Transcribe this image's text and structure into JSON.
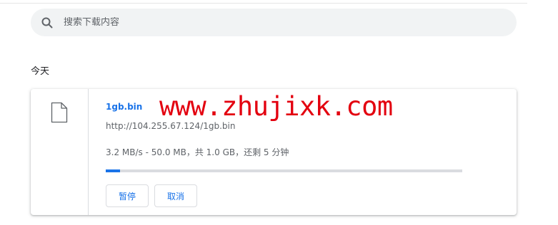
{
  "search": {
    "placeholder": "搜索下载内容"
  },
  "section": {
    "heading": "今天"
  },
  "download": {
    "file_name": "1gb.bin",
    "url": "http://104.255.67.124/1gb.bin",
    "status": "3.2 MB/s - 50.0 MB，共 1.0 GB，还剩 5 分钟",
    "progress_fraction": 0.04,
    "pause_label": "暂停",
    "cancel_label": "取消",
    "file_icon": "file-icon"
  },
  "watermark": {
    "text": "www.zhujixk.com",
    "color": "#e3000f"
  },
  "colors": {
    "accent": "#1a73e8",
    "secondary_text": "#5f6368",
    "search_background": "#f1f3f4"
  }
}
